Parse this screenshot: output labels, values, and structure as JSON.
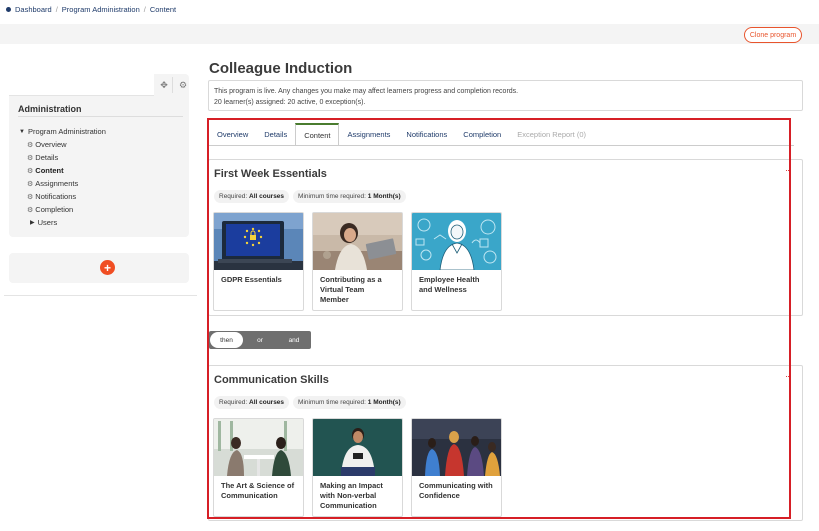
{
  "breadcrumb": {
    "items": [
      "Dashboard",
      "Program Administration",
      "Content"
    ],
    "separator": "/"
  },
  "header": {
    "clone_label": "Clone program"
  },
  "sidebar": {
    "title": "Administration",
    "tree_root": "Program Administration",
    "items": [
      {
        "label": "Overview",
        "active": false
      },
      {
        "label": "Details",
        "active": false
      },
      {
        "label": "Content",
        "active": true
      },
      {
        "label": "Assignments",
        "active": false
      },
      {
        "label": "Notifications",
        "active": false
      },
      {
        "label": "Completion",
        "active": false
      }
    ],
    "users_label": "Users",
    "add_symbol": "+"
  },
  "page": {
    "title": "Colleague Induction",
    "notice_line1": "This program is live. Any changes you make may affect learners progress and completion records.",
    "notice_line2": "20 learner(s) assigned: 20 active, 0 exception(s)."
  },
  "tabs": [
    {
      "label": "Overview",
      "state": "normal"
    },
    {
      "label": "Details",
      "state": "normal"
    },
    {
      "label": "Content",
      "state": "active"
    },
    {
      "label": "Assignments",
      "state": "normal"
    },
    {
      "label": "Notifications",
      "state": "normal"
    },
    {
      "label": "Completion",
      "state": "normal"
    },
    {
      "label": "Exception Report (0)",
      "state": "disabled"
    }
  ],
  "course_sets": [
    {
      "title": "First Week Essentials",
      "required_label": "Required:",
      "required_value": "All courses",
      "min_time_label": "Minimum time required:",
      "min_time_value": "1 Month(s)",
      "menu": "···",
      "courses": [
        {
          "name": "GDPR Essentials"
        },
        {
          "name": "Contributing as a Virtual Team Member"
        },
        {
          "name": "Employee Health and Wellness"
        }
      ]
    },
    {
      "title": "Communication Skills",
      "required_label": "Required:",
      "required_value": "All courses",
      "min_time_label": "Minimum time required:",
      "min_time_value": "1 Month(s)",
      "menu": "···",
      "courses": [
        {
          "name": "The Art & Science of Communication"
        },
        {
          "name": "Making an Impact with Non-verbal Communication"
        },
        {
          "name": "Communicating with Confidence"
        }
      ]
    }
  ],
  "operators": {
    "options": [
      "then",
      "or",
      "and"
    ],
    "selected": "then"
  },
  "colors": {
    "accent": "#e8552d",
    "add_button": "#f04e23",
    "highlight_frame": "#d61f26",
    "active_tab_bar": "#4a7c2f",
    "link": "#1f3b6a"
  },
  "icons": {
    "move": "move-icon",
    "settings": "gear-icon",
    "tree_item": "settings-cog-icon",
    "expand": "caret-down-icon",
    "collapse": "caret-right-icon"
  }
}
